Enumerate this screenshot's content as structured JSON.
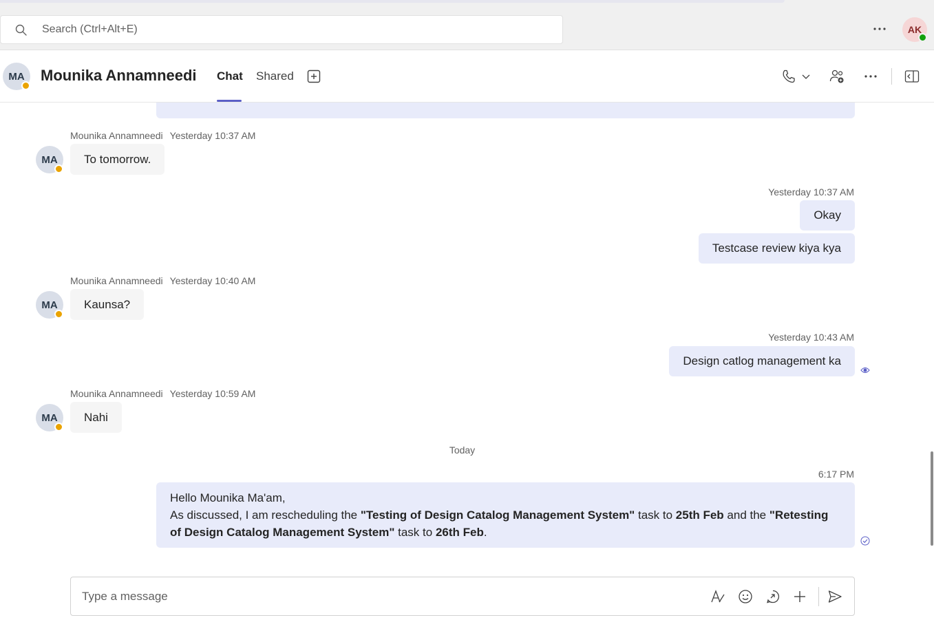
{
  "search": {
    "placeholder": "Search (Ctrl+Alt+E)"
  },
  "me": {
    "initials": "AK"
  },
  "header": {
    "initials": "MA",
    "name": "Mounika Annamneedi",
    "tabs": [
      {
        "label": "Chat",
        "active": true
      },
      {
        "label": "Shared",
        "active": false
      }
    ]
  },
  "messages": [
    {
      "direction": "in",
      "sender": "Mounika Annamneedi",
      "time": "Yesterday 10:37 AM",
      "initials": "MA",
      "texts": [
        "To tomorrow."
      ]
    },
    {
      "direction": "out",
      "time": "Yesterday 10:37 AM",
      "texts": [
        "Okay",
        "Testcase review kiya kya"
      ]
    },
    {
      "direction": "in",
      "sender": "Mounika Annamneedi",
      "time": "Yesterday 10:40 AM",
      "initials": "MA",
      "texts": [
        "Kaunsa?"
      ]
    },
    {
      "direction": "out",
      "time": "Yesterday 10:43 AM",
      "texts": [
        "Design catlog management ka"
      ]
    },
    {
      "direction": "in",
      "sender": "Mounika Annamneedi",
      "time": "Yesterday 10:59 AM",
      "initials": "MA",
      "texts": [
        "Nahi"
      ]
    }
  ],
  "day_separator": "Today",
  "last_message": {
    "time": "6:17 PM",
    "greeting": "Hello Mounika Ma'am,",
    "parts": {
      "p1": "As discussed, I am rescheduling the ",
      "b1": "\"Testing of Design Catalog Management System\"",
      "p2": " task to ",
      "b2": "25th Feb",
      "p3": " and the ",
      "b3": "\"Retesting of Design Catalog Management System\"",
      "p4": " task to ",
      "b4": "26th Feb",
      "p5": "."
    }
  },
  "composer": {
    "placeholder": "Type a message"
  },
  "colors": {
    "accent": "#5b5fc7",
    "out_bubble": "#e8ebfa",
    "in_bubble": "#f5f5f5",
    "away": "#eaa300",
    "available": "#13a10e"
  }
}
